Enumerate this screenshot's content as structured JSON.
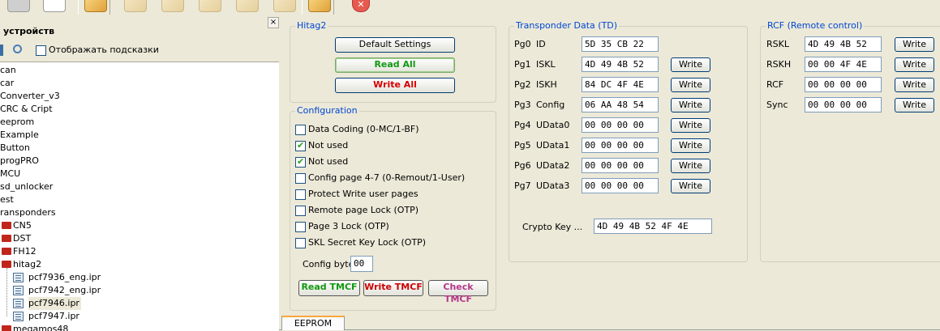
{
  "toolbar": {
    "icons": [
      "doc-grey-icon",
      "doc-white-icon",
      "edit-icon",
      "edit-icon",
      "edit-icon",
      "edit-icon",
      "edit-icon",
      "edit-icon",
      "stop-icon"
    ]
  },
  "left": {
    "title": "устройств",
    "close": "×",
    "show_hints": "Отображать подсказки",
    "tree": [
      {
        "label": "can",
        "indent": 0,
        "kind": "text"
      },
      {
        "label": "car",
        "indent": 0,
        "kind": "text"
      },
      {
        "label": "Converter_v3",
        "indent": 0,
        "kind": "text"
      },
      {
        "label": "CRC & Cript",
        "indent": 0,
        "kind": "text"
      },
      {
        "label": "eeprom",
        "indent": 0,
        "kind": "text"
      },
      {
        "label": "Example",
        "indent": 0,
        "kind": "text"
      },
      {
        "label": "Button",
        "indent": 0,
        "kind": "text"
      },
      {
        "label": "progPRO",
        "indent": 0,
        "kind": "text"
      },
      {
        "label": "MCU",
        "indent": 0,
        "kind": "text"
      },
      {
        "label": "sd_unlocker",
        "indent": 0,
        "kind": "text"
      },
      {
        "label": "est",
        "indent": 0,
        "kind": "text"
      },
      {
        "label": "ransponders",
        "indent": 0,
        "kind": "text"
      },
      {
        "label": "CN5",
        "indent": 1,
        "kind": "folder"
      },
      {
        "label": "DST",
        "indent": 1,
        "kind": "folder"
      },
      {
        "label": "FH12",
        "indent": 1,
        "kind": "folder"
      },
      {
        "label": "hitag2",
        "indent": 1,
        "kind": "folder"
      },
      {
        "label": "pcf7936_eng.ipr",
        "indent": 2,
        "kind": "file"
      },
      {
        "label": "pcf7942_eng.ipr",
        "indent": 2,
        "kind": "file"
      },
      {
        "label": "pcf7946.ipr",
        "indent": 2,
        "kind": "file",
        "selected": true
      },
      {
        "label": "pcf7947.ipr",
        "indent": 2,
        "kind": "file"
      },
      {
        "label": "megamos48",
        "indent": 1,
        "kind": "folder"
      }
    ]
  },
  "hitag": {
    "title": "Hitag2",
    "default_settings": "Default Settings",
    "read_all": "Read All",
    "write_all": "Write All"
  },
  "config": {
    "title": "Configuration",
    "items": [
      {
        "label": "Data Coding (0-MC/1-BF)",
        "checked": false
      },
      {
        "label": "Not used",
        "checked": true
      },
      {
        "label": "Not used",
        "checked": true
      },
      {
        "label": "Config page 4-7 (0-Remout/1-User)",
        "checked": false
      },
      {
        "label": "Protect Write user pages",
        "checked": false
      },
      {
        "label": "Remote page Lock (OTP)",
        "checked": false
      },
      {
        "label": "Page 3 Lock (OTP)",
        "checked": false
      },
      {
        "label": "SKL Secret Key Lock (OTP)",
        "checked": false
      }
    ],
    "config_byte_label": "Config byte",
    "config_byte_value": "00",
    "read_tmcf": "Read TMCF",
    "write_tmcf": "Write TMCF",
    "check_tmcf": "Check TMCF"
  },
  "td": {
    "title": "Transponder Data (TD)",
    "write_label": "Write",
    "rows": [
      {
        "page": "Pg0",
        "name": "ID",
        "value": "5D 35 CB 22",
        "write": false
      },
      {
        "page": "Pg1",
        "name": "ISKL",
        "value": "4D 49 4B 52",
        "write": true
      },
      {
        "page": "Pg2",
        "name": "ISKH",
        "value": "84 DC 4F 4E",
        "write": true
      },
      {
        "page": "Pg3",
        "name": "Config",
        "value": "06 AA 48 54",
        "write": true
      },
      {
        "page": "Pg4",
        "name": "UData0",
        "value": "00 00 00 00",
        "write": true
      },
      {
        "page": "Pg5",
        "name": "UData1",
        "value": "00 00 00 00",
        "write": true
      },
      {
        "page": "Pg6",
        "name": "UData2",
        "value": "00 00 00 00",
        "write": true
      },
      {
        "page": "Pg7",
        "name": "UData3",
        "value": "00 00 00 00",
        "write": true
      }
    ],
    "crypto_label": "Crypto Key  ...",
    "crypto_value": "4D 49 4B 52 4F 4E"
  },
  "rcf": {
    "title": "RCF (Remote control)",
    "write_label": "Write",
    "rows": [
      {
        "name": "RSKL",
        "value": "4D 49 4B 52"
      },
      {
        "name": "RSKH",
        "value": "00 00 4F 4E"
      },
      {
        "name": "RCF",
        "value": "00 00 00 00"
      },
      {
        "name": "Sync",
        "value": "00 00 00 00"
      }
    ]
  },
  "tabs": {
    "eeprom": "EEPROM"
  }
}
